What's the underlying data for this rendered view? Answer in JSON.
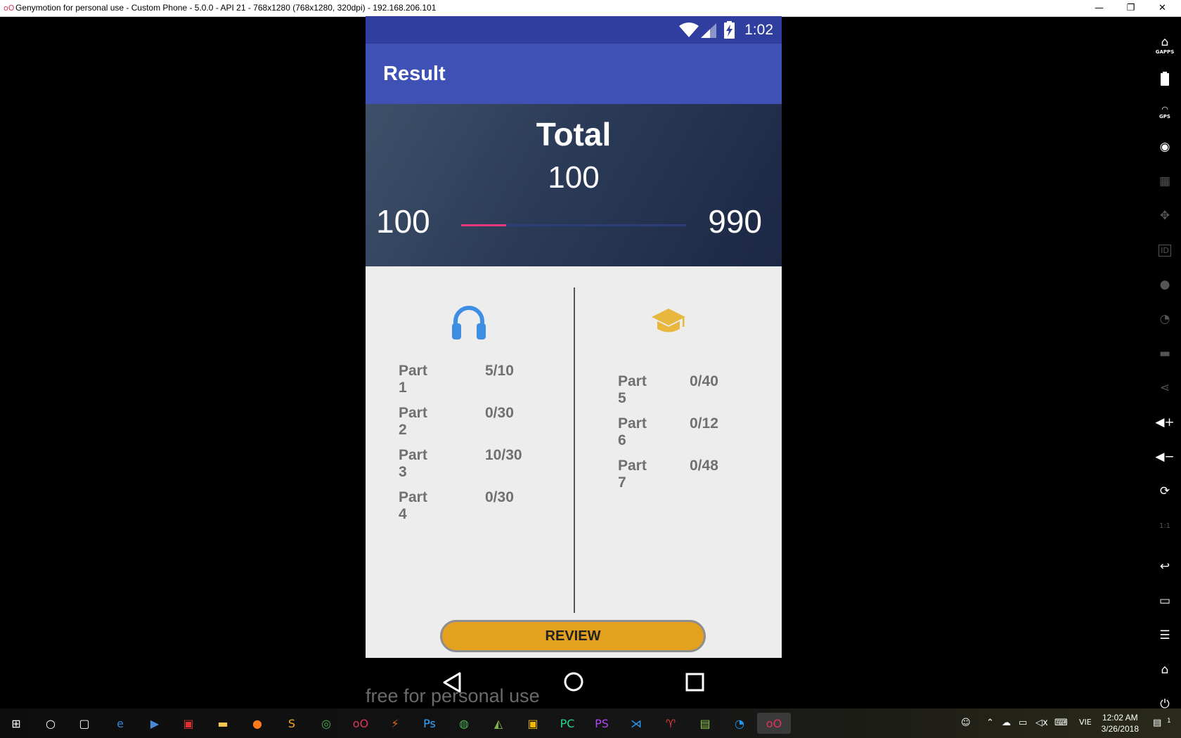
{
  "window": {
    "title": "Genymotion for personal use - Custom Phone - 5.0.0 - API 21 - 768x1280 (768x1280, 320dpi) - 192.168.206.101",
    "logo": "oO",
    "minimize": "—",
    "restore": "❐",
    "close": "✕"
  },
  "status_bar": {
    "time": "1:02"
  },
  "app_bar": {
    "title": "Result"
  },
  "total": {
    "label": "Total",
    "value": "100",
    "min": "100",
    "max": "990",
    "progress_fraction": 0.2,
    "progress_color": "#e5397a"
  },
  "listening": {
    "icon": "headphones-icon",
    "color": "#3e8fe4",
    "parts": [
      {
        "label": "Part 1",
        "score": "5/10"
      },
      {
        "label": "Part 2",
        "score": "0/30"
      },
      {
        "label": "Part 3",
        "score": "10/30"
      },
      {
        "label": "Part 4",
        "score": "0/30"
      }
    ]
  },
  "reading": {
    "icon": "graduation-cap-icon",
    "color": "#e8b73e",
    "parts": [
      {
        "label": "Part 5",
        "score": "0/40"
      },
      {
        "label": "Part 6",
        "score": "0/12"
      },
      {
        "label": "Part 7",
        "score": "0/48"
      }
    ]
  },
  "review_button": {
    "label": "REVIEW",
    "color": "#e4a11e"
  },
  "watermark": "free for personal use",
  "toolbar": {
    "gapps_label": "GAPPS",
    "gps_label": "GPS",
    "id_label": "ID",
    "pixel_label": "1:1"
  },
  "taskbar": {
    "language": "VIE",
    "time": "12:02 AM",
    "date": "3/26/2018",
    "notification_count": "1"
  }
}
